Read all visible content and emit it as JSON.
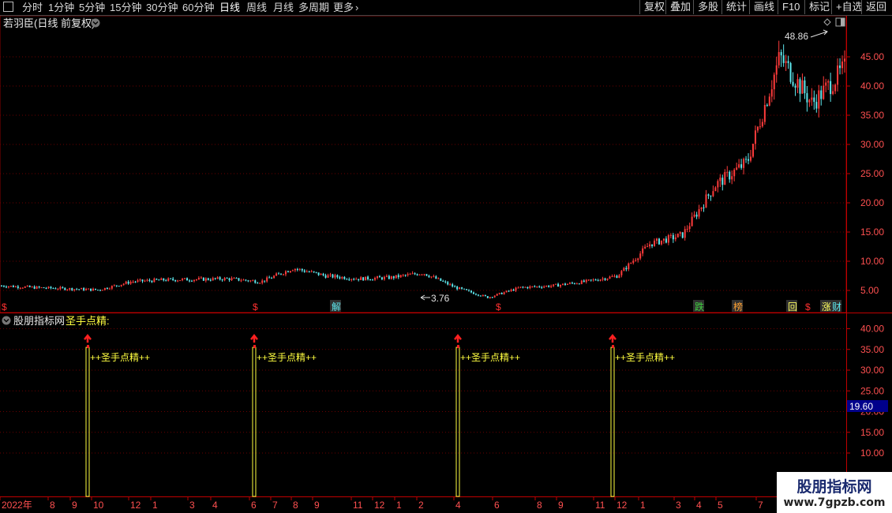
{
  "toolbar": {
    "periods": [
      "分时",
      "1分钟",
      "5分钟",
      "15分钟",
      "30分钟",
      "60分钟",
      "日线",
      "周线",
      "月线",
      "多周期",
      "更多"
    ],
    "active_period": "日线",
    "buttons": [
      "复权",
      "叠加",
      "多股",
      "统计",
      "画线",
      "F10",
      "+自选",
      "返回"
    ]
  },
  "main_panel": {
    "title": "若羽臣(日线 前复权)",
    "y_ticks": [
      "45.00",
      "40.00",
      "35.00",
      "30.00",
      "25.00",
      "20.00",
      "15.00",
      "10.00",
      "5.00"
    ],
    "y_range": [
      3,
      50
    ],
    "high_label": "48.86",
    "low_label": "3.76",
    "event_markers": [
      "$",
      "$",
      "解",
      "$",
      "跌",
      "榜",
      "回",
      "$",
      "涨",
      "财"
    ],
    "colors": {
      "up": "#ff3b3b",
      "down": "#5ee8ee",
      "grid": "#6a0000",
      "tick_text": "#ff5050"
    }
  },
  "sub_panel": {
    "title": "股朋指标网",
    "indicator": "圣手点精:",
    "y_ticks": [
      "40.00",
      "35.00",
      "30.00",
      "25.00",
      "20.00",
      "15.00",
      "10.00"
    ],
    "y_range": [
      0,
      43
    ],
    "current_value": "19.60",
    "signal_label": "++圣手点精++",
    "signal_count": 4,
    "signal_value": 35.5
  },
  "x_axis": {
    "labels": [
      "2022年",
      "8",
      "9",
      "10",
      "12",
      "1",
      "3",
      "4",
      "6",
      "7",
      "8",
      "9",
      "11",
      "12",
      "1",
      "2",
      "4",
      "6",
      "8",
      "9",
      "11",
      "12",
      "1",
      "3",
      "4",
      "5",
      "7"
    ]
  },
  "watermark": {
    "title": "股朋指标网",
    "url": "www.7gpzb.com"
  },
  "chart_data": {
    "type": "candlestick",
    "title": "若羽臣(日线 前复权)",
    "series": [
      {
        "name": "price",
        "x": [
          "2022年",
          "8",
          "9",
          "10",
          "12",
          "1",
          "3",
          "4",
          "6",
          "7",
          "8",
          "9",
          "11",
          "12",
          "1",
          "2",
          "4",
          "6",
          "8",
          "9",
          "11",
          "12",
          "1",
          "3",
          "4",
          "5",
          "7"
        ],
        "values": [
          5.8,
          5.5,
          5.3,
          5.1,
          6.5,
          6.8,
          6.9,
          7.0,
          6.5,
          8.8,
          7.5,
          7.0,
          7.2,
          8.0,
          5.5,
          3.8,
          5.5,
          5.8,
          6.5,
          7.5,
          13.0,
          14.5,
          23,
          27,
          45,
          37,
          43
        ]
      },
      {
        "name": "圣手点精",
        "values": [
          35.5,
          35.5,
          35.5,
          35.5
        ]
      }
    ],
    "ylim": [
      3,
      50
    ]
  }
}
